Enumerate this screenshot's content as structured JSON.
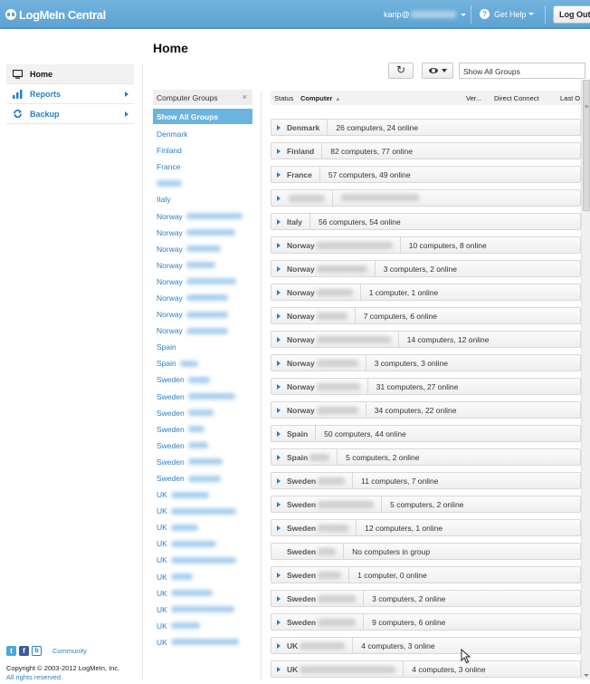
{
  "header": {
    "app_name": "LogMeIn Central",
    "user": "karip@",
    "help_label": "Get Help",
    "logout_label": "Log Out"
  },
  "page": {
    "title": "Home"
  },
  "nav": {
    "items": [
      {
        "label": "Home",
        "icon": "monitor-icon",
        "active": true
      },
      {
        "label": "Reports",
        "icon": "bar-chart-icon",
        "active": false
      },
      {
        "label": "Backup",
        "icon": "refresh-icon",
        "active": false
      }
    ]
  },
  "footer": {
    "community_label": "Community",
    "copyright": "Copyright © 2003-2012 LogMeIn, Inc.",
    "rights": "All rights reserved."
  },
  "groups_panel": {
    "title": "Computer Groups",
    "close": "×",
    "show_all": "Show All Groups",
    "items": [
      {
        "label": "Denmark",
        "blur": 0
      },
      {
        "label": "Finland",
        "blur": 0
      },
      {
        "label": "France",
        "blur": 0
      },
      {
        "label": "",
        "blur": 28
      },
      {
        "label": "Italy",
        "blur": 0
      },
      {
        "label": "Norway",
        "blur": 62
      },
      {
        "label": "Norway",
        "blur": 54
      },
      {
        "label": "Norway",
        "blur": 38
      },
      {
        "label": "Norway",
        "blur": 32
      },
      {
        "label": "Norway",
        "blur": 55
      },
      {
        "label": "Norway",
        "blur": 46
      },
      {
        "label": "Norway",
        "blur": 46
      },
      {
        "label": "Norway",
        "blur": 46
      },
      {
        "label": "Spain",
        "blur": 0
      },
      {
        "label": "Spain",
        "blur": 20
      },
      {
        "label": "Sweden",
        "blur": 24
      },
      {
        "label": "Sweden",
        "blur": 52
      },
      {
        "label": "Sweden",
        "blur": 28
      },
      {
        "label": "Sweden",
        "blur": 18
      },
      {
        "label": "Sweden",
        "blur": 22
      },
      {
        "label": "Sweden",
        "blur": 38
      },
      {
        "label": "Sweden",
        "blur": 36
      },
      {
        "label": "UK",
        "blur": 42
      },
      {
        "label": "UK",
        "blur": 72
      },
      {
        "label": "UK",
        "blur": 30
      },
      {
        "label": "UK",
        "blur": 50
      },
      {
        "label": "UK",
        "blur": 72
      },
      {
        "label": "UK",
        "blur": 24
      },
      {
        "label": "UK",
        "blur": 46
      },
      {
        "label": "UK",
        "blur": 70
      },
      {
        "label": "UK",
        "blur": 32
      },
      {
        "label": "UK",
        "blur": 75
      }
    ]
  },
  "toolbar": {
    "refresh_glyph": "↻",
    "group_filter": "Show All Groups"
  },
  "table": {
    "columns": [
      "Status",
      "Computer",
      "Ver...",
      "Direct Connect",
      "Last O"
    ],
    "sort_indicator": "▲",
    "rows": [
      {
        "group": "Denmark",
        "blur": 0,
        "count": "26 computers, 24 online",
        "expandable": true
      },
      {
        "group": "Finland",
        "blur": 0,
        "count": "82 computers, 77 online",
        "expandable": true
      },
      {
        "group": "France",
        "blur": 0,
        "count": "57 computers, 49 online",
        "expandable": true
      },
      {
        "group": "",
        "blur": 40,
        "count": "",
        "count_blur": 86,
        "expandable": true
      },
      {
        "group": "Italy",
        "blur": 0,
        "count": "56 computers, 54 online",
        "expandable": true
      },
      {
        "group": "Norway",
        "blur": 84,
        "count": "10 computers, 8 online",
        "expandable": true
      },
      {
        "group": "Norway",
        "blur": 56,
        "count": "3 computers, 2 online",
        "expandable": true
      },
      {
        "group": "Norway",
        "blur": 40,
        "count": "1 computer, 1 online",
        "expandable": true
      },
      {
        "group": "Norway",
        "blur": 34,
        "count": "7 computers, 6 online",
        "expandable": true
      },
      {
        "group": "Norway",
        "blur": 82,
        "count": "14 computers, 12 online",
        "expandable": true
      },
      {
        "group": "Norway",
        "blur": 46,
        "count": "3 computers, 3 online",
        "expandable": true
      },
      {
        "group": "Norway",
        "blur": 48,
        "count": "31 computers, 27 online",
        "expandable": true
      },
      {
        "group": "Norway",
        "blur": 46,
        "count": "34 computers, 22 online",
        "expandable": true
      },
      {
        "group": "Spain",
        "blur": 0,
        "count": "50 computers, 44 online",
        "expandable": true
      },
      {
        "group": "Spain",
        "blur": 22,
        "count": "5 computers, 2 online",
        "expandable": true
      },
      {
        "group": "Sweden",
        "blur": 30,
        "count": "11 computers, 7 online",
        "expandable": true
      },
      {
        "group": "Sweden",
        "blur": 62,
        "count": "5 computers, 2 online",
        "expandable": true
      },
      {
        "group": "Sweden",
        "blur": 34,
        "count": "12 computers, 1 online",
        "expandable": true
      },
      {
        "group": "Sweden",
        "blur": 20,
        "count": "No computers in group",
        "expandable": false
      },
      {
        "group": "Sweden",
        "blur": 26,
        "count": "1 computer, 0 online",
        "expandable": true
      },
      {
        "group": "Sweden",
        "blur": 42,
        "count": "3 computers, 2 online",
        "expandable": true
      },
      {
        "group": "Sweden",
        "blur": 42,
        "count": "9 computers, 6 online",
        "expandable": true
      },
      {
        "group": "UK",
        "blur": 50,
        "count": "4 computers, 3 online",
        "expandable": true
      },
      {
        "group": "UK",
        "blur": 106,
        "count": "4 computers, 3 online",
        "expandable": true
      }
    ]
  },
  "colors": {
    "accent": "#2a7fc7",
    "header_bg": "#5ea3d3",
    "selected_group": "#6ab4e0"
  }
}
